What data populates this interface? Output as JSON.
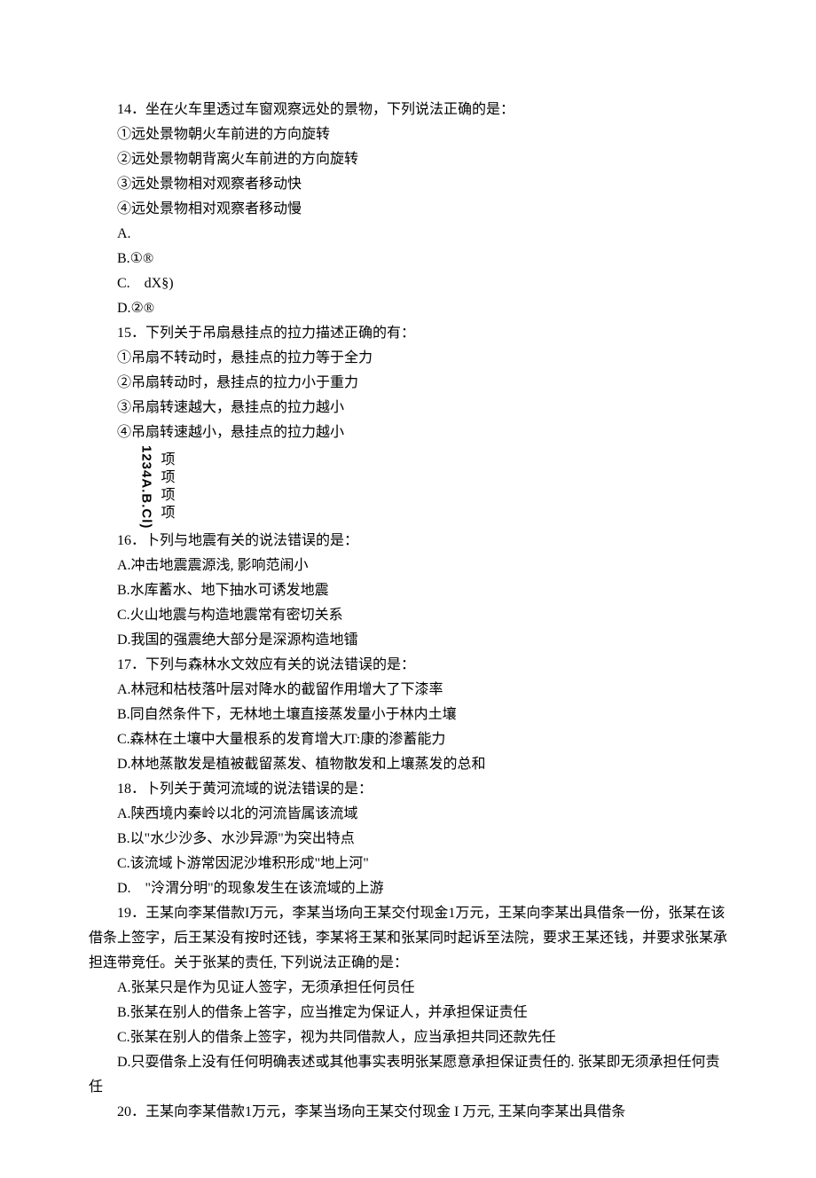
{
  "q14": {
    "num": "14",
    "stem": "．坐在火车里透过车窗观察远处的景物，下列说法正确的是：",
    "s1": "①远处景物朝火车前进的方向旋转",
    "s2": "②远处景物朝背离火车前进的方向旋转",
    "s3": "③远处景物相对观察者移动快",
    "s4": "④远处景物相对观察者移动慢",
    "a": "A.",
    "b": "B.①®",
    "c": "C.　dX§)",
    "d": "D.②®"
  },
  "q15": {
    "num": "15",
    "stem": "．下列关于吊扇悬挂点的拉力描述正确的有：",
    "s1": "①吊扇不转动时，悬挂点的拉力等于全力",
    "s2": "②吊扇转动时，悬挂点的拉力小于重力",
    "s3": "③吊扇转速越大，悬挂点的拉力越小",
    "s4": "④吊扇转速越小，悬挂点的拉力越小",
    "vlabel": "1234A.B.Cl)",
    "v1": "项",
    "v2": "项",
    "v3": "项",
    "v4": "项"
  },
  "q16": {
    "num": "16",
    "stem": "．卜列与地震有关的说法错误的是：",
    "a": "A.冲击地震震源浅, 影响范闹小",
    "b": "B.水库蓄水、地下抽水可诱发地震",
    "c": "C.火山地震与构造地震常有密切关系",
    "d": "D.我国的强震绝大部分是深源构造地镭"
  },
  "q17": {
    "num": "17",
    "stem": "．下列与森林水文效应有关的说法错误的是：",
    "a": "A.林冠和枯枝落叶层对降水的截留作用增大了下漆率",
    "b": "B.同自然条件下，无林地土壤直接蒸发量小于林内土壤",
    "c": "C.森林在土壤中大量根系的发育增大JT:康的渗蓄能力",
    "d": "D.林地蒸散发是植被截留蒸发、植物散发和上壤蒸发的总和"
  },
  "q18": {
    "num": "18",
    "stem": "．卜列关于黄河流域的说法错误的是：",
    "a": "A.陕西境内秦岭以北的河流皆属该流域",
    "b": "B.以\"水少沙多、水沙异源\"为突出特点",
    "c": "C.该流域卜游常因泥沙堆积形成\"地上河\"",
    "d": "D.　\"泠渭分明\"的现象发生在该流域的上游"
  },
  "q19": {
    "num": "19",
    "stem": "．王某向李某借款I万元，李某当场向王某交付现金1万元，王某向李某出具借条一份，张某在该借条上签字，后王某没有按时还钱，李某将王某和张某同时起诉至法院，要求王某还钱，并要求张某承担连带竞任。关于张某的责任, 下列说法正确的是：",
    "a": "A.张某只是作为见证人签字，无须承担任何员任",
    "b": "B.张某在别人的借条上答字，应当推定为保证人，并承担保证责任",
    "c": "C.张某在别人的借条上签字，视为共同借款人，应当承担共同还款先任",
    "d": "D.只耍借条上没有任何明确表述或其他事实表明张某愿意承担保证责任的. 张某即无须承担任何责任"
  },
  "q20": {
    "num": "20",
    "stem": "．王某向李某借款1万元，李某当场向王某交付现金 I 万元, 王某向李某出具借条"
  }
}
